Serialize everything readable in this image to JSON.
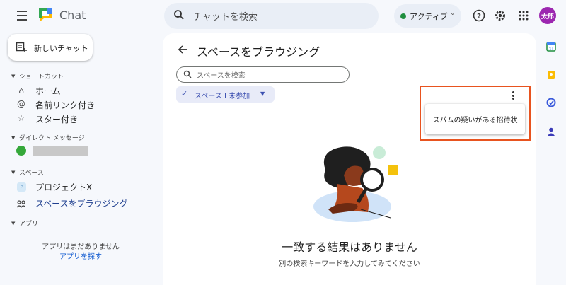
{
  "header": {
    "app_name": "Chat",
    "search_placeholder": "チャットを検索",
    "status_label": "アクティブ",
    "avatar_text": "太郎"
  },
  "sidebar": {
    "new_chat_label": "新しいチャット",
    "sections": {
      "shortcuts": "ショートカット",
      "direct_messages": "ダイレクト メッセージ",
      "spaces": "スペース",
      "apps": "アプリ"
    },
    "shortcuts": [
      {
        "icon": "home-icon",
        "label": "ホーム"
      },
      {
        "icon": "at-icon",
        "label": "名前リンク付き"
      },
      {
        "icon": "star-icon",
        "label": "スター付き"
      }
    ],
    "spaces": [
      {
        "icon": "space-icon",
        "label": "プロジェクトX"
      },
      {
        "icon": "browse-spaces-icon",
        "label": "スペースをブラウジング"
      }
    ],
    "apps_empty": "アプリはまだありません",
    "apps_link": "アプリを探す"
  },
  "main": {
    "title": "スペースをブラウジング",
    "search_placeholder": "スペースを検索",
    "filter_label": "スペース I 未参加",
    "menu_item": "スパムの疑いがある招待状",
    "empty_title": "一致する結果はありません",
    "empty_subtitle": "別の検索キーワードを入力してみてください"
  },
  "colors": {
    "accent": "#0b57d0",
    "chip": "#e8ebf8",
    "highlight": "#e8531f",
    "status_green": "#1e8e3e"
  }
}
